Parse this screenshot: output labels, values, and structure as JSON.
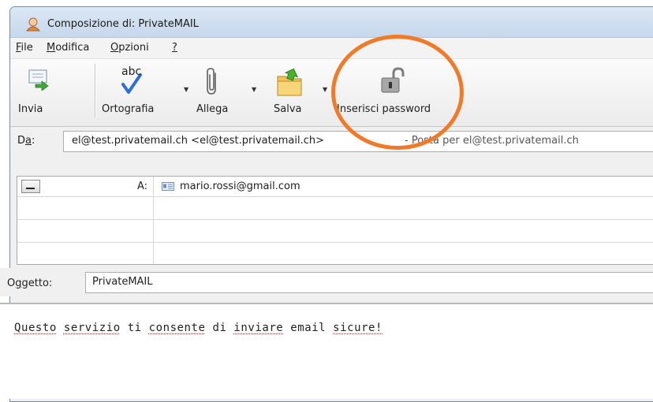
{
  "window": {
    "title": "Composizione di: PrivateMAIL"
  },
  "menu": {
    "items": [
      {
        "label": "File",
        "accel": "F",
        "rest": "ile"
      },
      {
        "label": "Modifica",
        "accel": "M",
        "rest": "odifica"
      },
      {
        "label": "Opzioni",
        "accel": "O",
        "rest": "pzioni"
      },
      {
        "label": "?",
        "accel": "?",
        "rest": ""
      }
    ]
  },
  "toolbar": {
    "send_label": "Invia",
    "spelling_label": "Ortografia",
    "spelling_icon_text": "abc",
    "attach_label": "Allega",
    "save_label": "Salva",
    "password_label": "Inserisci password"
  },
  "from": {
    "label_accel": "a",
    "label_pre": "D",
    "label_post": ":",
    "value": "el@test.privatemail.ch <el@test.privatemail.ch>",
    "description": "- Posta per el@test.privatemail.ch"
  },
  "recipients": {
    "to_label": "A:",
    "to_value": "mario.rossi@gmail.com"
  },
  "subject": {
    "label_pre": "O",
    "label_accel": "g",
    "label_post": "getto:",
    "value": "PrivateMAIL"
  },
  "body": {
    "words": [
      "Questo",
      "servizio",
      "ti",
      "consente",
      "di",
      "inviare",
      "email",
      "sicure!"
    ],
    "spell_flagged": [
      true,
      true,
      false,
      true,
      false,
      true,
      false,
      true
    ]
  },
  "colors": {
    "highlight_circle": "#f07a28"
  }
}
